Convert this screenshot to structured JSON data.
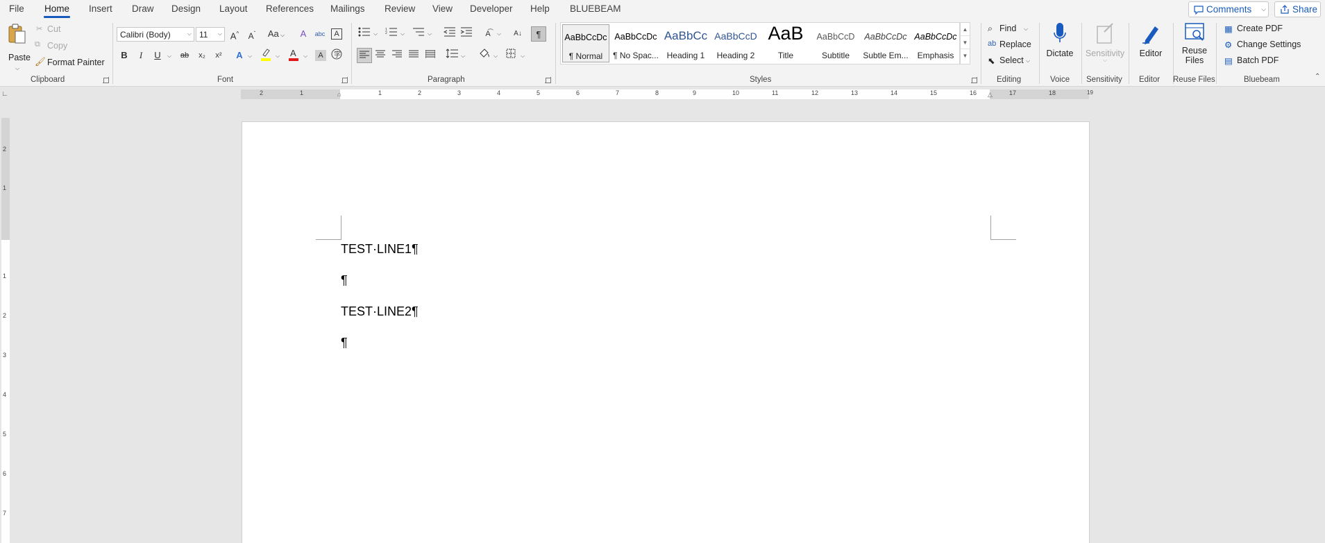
{
  "menu": {
    "tabs": [
      "File",
      "Home",
      "Insert",
      "Draw",
      "Design",
      "Layout",
      "References",
      "Mailings",
      "Review",
      "View",
      "Developer",
      "Help",
      "BLUEBEAM"
    ],
    "active_tab": "Home",
    "comments_label": "Comments",
    "share_label": "Share"
  },
  "clipboard": {
    "paste": "Paste",
    "cut": "Cut",
    "copy": "Copy",
    "format_painter": "Format Painter",
    "group": "Clipboard"
  },
  "font": {
    "name": "Calibri (Body)",
    "size": "11",
    "group": "Font",
    "grow_icon": "A^",
    "shrink_icon": "Aˇ",
    "case_icon": "Aa",
    "bold": "B",
    "italic": "I",
    "underline": "U",
    "strike": "ab",
    "subscript": "x₂",
    "superscript": "x²"
  },
  "paragraph": {
    "group": "Paragraph",
    "pilcrow": "¶"
  },
  "styles": {
    "group": "Styles",
    "items": [
      {
        "preview": "AaBbCcDc",
        "name": "¶ Normal"
      },
      {
        "preview": "AaBbCcDc",
        "name": "¶ No Spac..."
      },
      {
        "preview": "AaBbCc",
        "name": "Heading 1"
      },
      {
        "preview": "AaBbCcD",
        "name": "Heading 2"
      },
      {
        "preview": "AaB",
        "name": "Title"
      },
      {
        "preview": "AaBbCcD",
        "name": "Subtitle"
      },
      {
        "preview": "AaBbCcDc",
        "name": "Subtle Em..."
      },
      {
        "preview": "AaBbCcDc",
        "name": "Emphasis"
      }
    ]
  },
  "editing": {
    "find": "Find",
    "replace": "Replace",
    "select": "Select",
    "group": "Editing"
  },
  "voice": {
    "dictate": "Dictate",
    "group": "Voice"
  },
  "sensitivity": {
    "button": "Sensitivity",
    "group": "Sensitivity"
  },
  "editor": {
    "button": "Editor",
    "group": "Editor"
  },
  "reuse": {
    "button_line1": "Reuse",
    "button_line2": "Files",
    "group": "Reuse Files"
  },
  "bluebeam": {
    "create_pdf": "Create PDF",
    "change_settings": "Change Settings",
    "batch_pdf": "Batch PDF",
    "group": "Bluebeam"
  },
  "ruler": {
    "h_ticks": [
      "2",
      "1",
      "1",
      "2",
      "3",
      "4",
      "5",
      "6",
      "7",
      "8",
      "9",
      "10",
      "11",
      "12",
      "13",
      "14",
      "15",
      "16",
      "17",
      "18",
      "19"
    ],
    "v_ticks": [
      "2",
      "1",
      "1",
      "2",
      "3",
      "4",
      "5",
      "6",
      "7"
    ]
  },
  "document": {
    "paragraphs": [
      "TEST·LINE1¶",
      "¶",
      "TEST·LINE2¶",
      "¶"
    ]
  },
  "colors": {
    "accent": "#185abd",
    "highlight": "#ffff00",
    "font_color": "#e01a1a"
  }
}
